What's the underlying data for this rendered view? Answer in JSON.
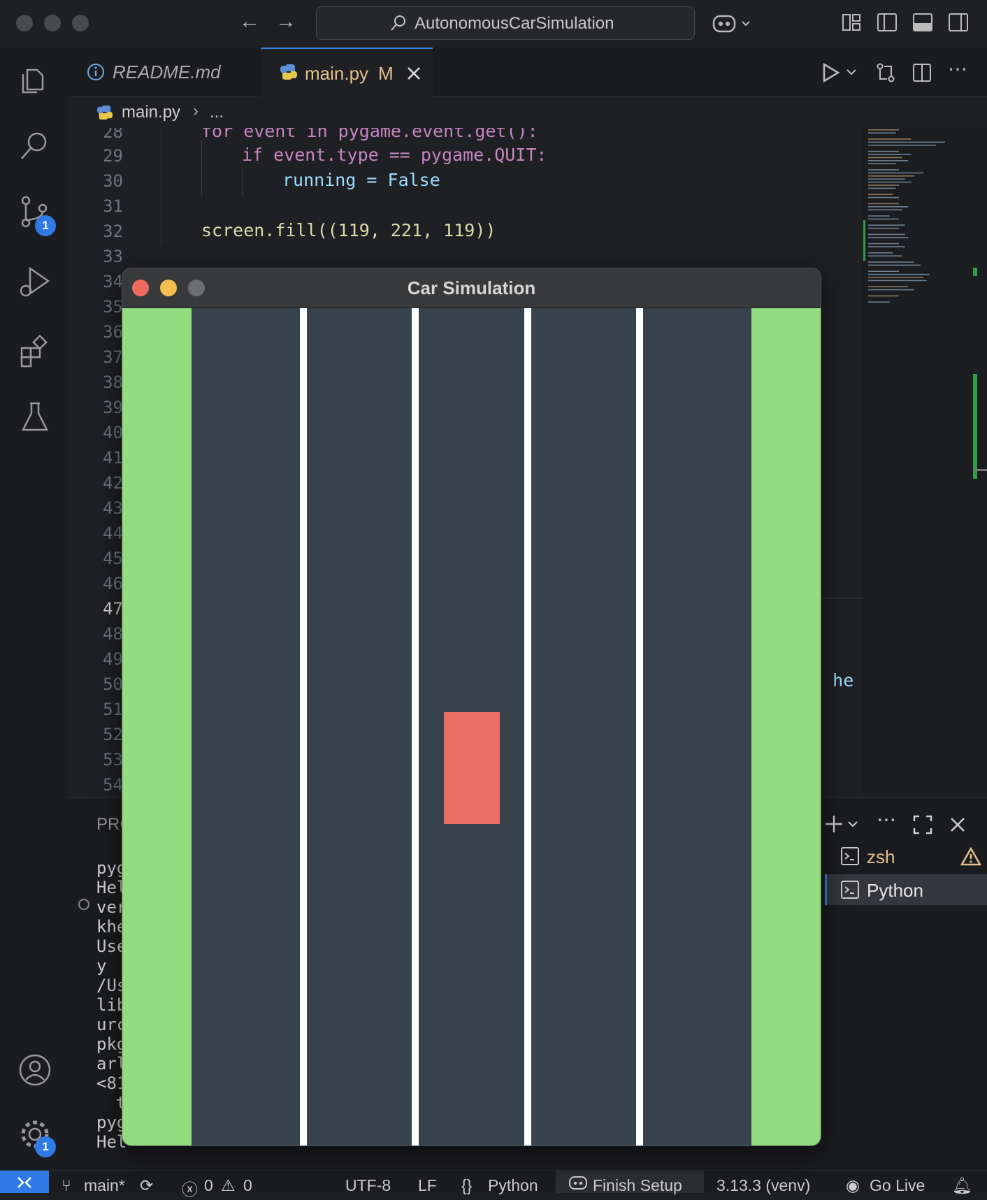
{
  "titlebar": {
    "search": "AutonomousCarSimulation"
  },
  "activity": {
    "scm_badge": "1",
    "settings_badge": "1"
  },
  "tabs": [
    {
      "label": "README.md"
    },
    {
      "label": "main.py",
      "status": "M"
    }
  ],
  "breadcrumb": {
    "file": "main.py",
    "more": "..."
  },
  "editor": {
    "lines": [
      {
        "n": "28",
        "code": "for event in pygame.event.get():"
      },
      {
        "n": "29",
        "code": "if event.type == pygame.QUIT:"
      },
      {
        "n": "30",
        "code": "running = False"
      },
      {
        "n": "31",
        "code": ""
      },
      {
        "n": "32",
        "code": "screen.fill((119, 221, 119))"
      },
      {
        "n": "33",
        "code": ""
      }
    ],
    "hidden_numbers": [
      "34",
      "35",
      "36",
      "37",
      "38",
      "39",
      "40",
      "41",
      "42",
      "43",
      "44",
      "45",
      "46",
      "47",
      "48",
      "49",
      "50",
      "51",
      "52",
      "53",
      "54"
    ],
    "side_fragment": "h, he"
  },
  "panel": {
    "tab_fragment": "PRC",
    "terminal_fragments": [
      "pyg",
      "Hel",
      "ver",
      "khe",
      "Use",
      "y",
      "/Us",
      "lib",
      "urc",
      "pkg",
      "arl",
      "<81",
      "t",
      "pyg",
      "Hel"
    ],
    "terminals": [
      {
        "name": "zsh"
      },
      {
        "name": "Python"
      }
    ]
  },
  "statusbar": {
    "branch": "main*",
    "errors": "0",
    "warnings": "0",
    "encoding": "UTF-8",
    "eol": "LF",
    "language": "Python",
    "setup": "Finish Setup",
    "interpreter": "3.13.3 (venv)",
    "golive": "Go Live"
  },
  "game": {
    "title": "Car Simulation",
    "grass_color": "#91dc7f",
    "road_color": "#37424c",
    "lane_line_color": "#ffffff",
    "car_color": "#ec6f66",
    "lane_count": 5
  }
}
